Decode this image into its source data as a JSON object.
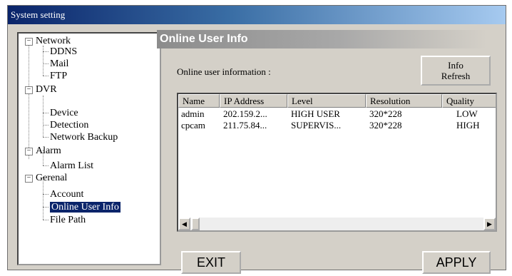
{
  "window": {
    "title": "System setting"
  },
  "tree": {
    "groups": [
      {
        "label": "Network",
        "children": [
          "DDNS",
          "Mail",
          "FTP"
        ]
      },
      {
        "label": "DVR",
        "children": [
          "Device",
          "Detection",
          "Network Backup"
        ]
      },
      {
        "label": "Alarm",
        "children": [
          "Alarm List"
        ]
      },
      {
        "label": "Gerenal",
        "children": [
          "Account",
          "Online User Info",
          "File Path"
        ]
      }
    ],
    "expander_symbol": "−",
    "selected": "Online User Info"
  },
  "panel": {
    "header": "Online User Info",
    "info_label": "Online user information :",
    "refresh_button": {
      "line1": "Info",
      "line2": "Refresh"
    }
  },
  "table": {
    "columns": [
      "Name",
      "IP Address",
      "Level",
      "Resolution",
      "Quality"
    ],
    "rows": [
      [
        "admin",
        "202.159.2...",
        "HIGH USER",
        "320*228",
        "LOW"
      ],
      [
        "cpcam",
        "211.75.84...",
        "SUPERVIS...",
        "320*228",
        "HIGH"
      ]
    ],
    "scroll_left": "◀",
    "scroll_right": "▶"
  },
  "buttons": {
    "exit": "EXIT",
    "apply": "APPLY"
  },
  "colors": {
    "title_start": "#0a246a",
    "title_end": "#a6caf0",
    "selection": "#0a246a",
    "face": "#d4d0c8"
  }
}
